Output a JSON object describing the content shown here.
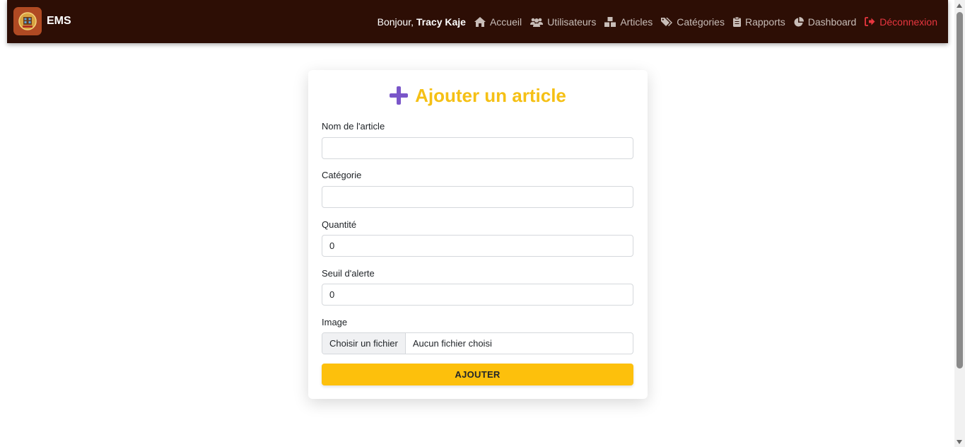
{
  "navbar": {
    "brand": "EMS",
    "greeting_prefix": "Bonjour, ",
    "user_name": "Tracy Kaje",
    "links": [
      {
        "label": "Accueil",
        "icon": "home-icon"
      },
      {
        "label": "Utilisateurs",
        "icon": "users-icon"
      },
      {
        "label": "Articles",
        "icon": "cubes-icon"
      },
      {
        "label": "Catégories",
        "icon": "tags-icon"
      },
      {
        "label": "Rapports",
        "icon": "clipboard-icon"
      },
      {
        "label": "Dashboard",
        "icon": "pie-chart-icon"
      },
      {
        "label": "Déconnexion",
        "icon": "sign-out-icon"
      }
    ]
  },
  "form": {
    "title": "Ajouter un article",
    "fields": [
      {
        "label": "Nom de l'article",
        "value": ""
      },
      {
        "label": "Catégorie",
        "value": ""
      },
      {
        "label": "Quantité",
        "value": "0"
      },
      {
        "label": "Seuil d'alerte",
        "value": "0"
      }
    ],
    "image": {
      "label": "Image",
      "button": "Choisir un fichier",
      "status": "Aucun fichier choisi"
    },
    "submit": "AJOUTER"
  },
  "colors": {
    "navbar_bg": "#2d0e05",
    "title": "#f5c015",
    "plus_icon": "#7a56c9",
    "submit_bg": "#fdc00c",
    "logout": "#e8363f"
  }
}
